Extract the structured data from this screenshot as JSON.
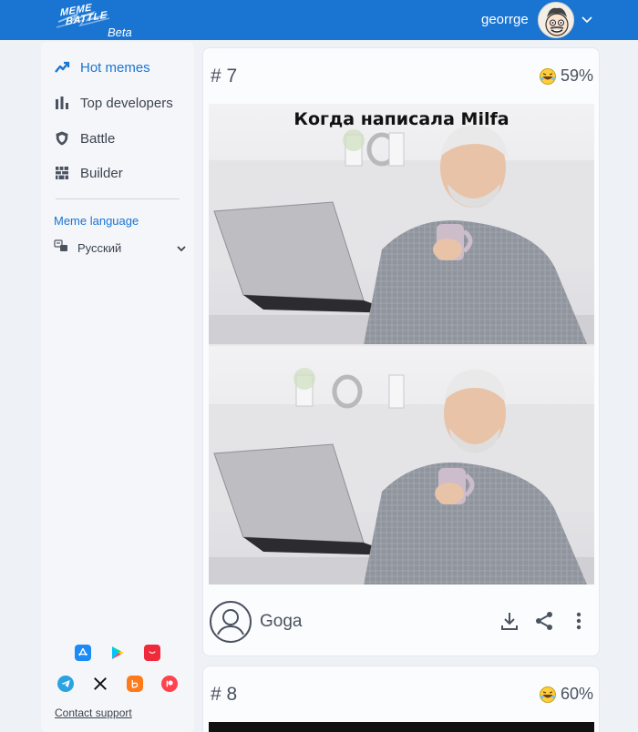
{
  "header": {
    "logo_line1": "MEME",
    "logo_line2": "BATTLE",
    "logo_tag": "Beta",
    "username": "georrge",
    "avatar_icon": "user-avatar",
    "menu_icon": "chevron-down-icon"
  },
  "sidebar": {
    "nav": [
      {
        "label": "Hot memes",
        "icon": "trending-icon",
        "active": true
      },
      {
        "label": "Top developers",
        "icon": "bar-chart-icon",
        "active": false
      },
      {
        "label": "Battle",
        "icon": "shield-icon",
        "active": false
      },
      {
        "label": "Builder",
        "icon": "grid-builder-icon",
        "active": false
      }
    ],
    "lang_title": "Meme language",
    "lang_value": "Русский",
    "apps_row1": [
      "app-store-icon",
      "google-play-icon",
      "huawei-gallery-icon"
    ],
    "apps_row2": [
      "telegram-icon",
      "x-icon",
      "bluesky-icon",
      "patreon-icon"
    ],
    "contact": "Contact support"
  },
  "feed": {
    "posts": [
      {
        "rank": "# 7",
        "score": "59%",
        "caption": "Когда написала Milfa",
        "author": "Goga"
      },
      {
        "rank": "# 8",
        "score": "60%"
      }
    ]
  },
  "colors": {
    "brand": "#1a75d2",
    "text": "#3d4450",
    "background": "#eef1f5"
  }
}
